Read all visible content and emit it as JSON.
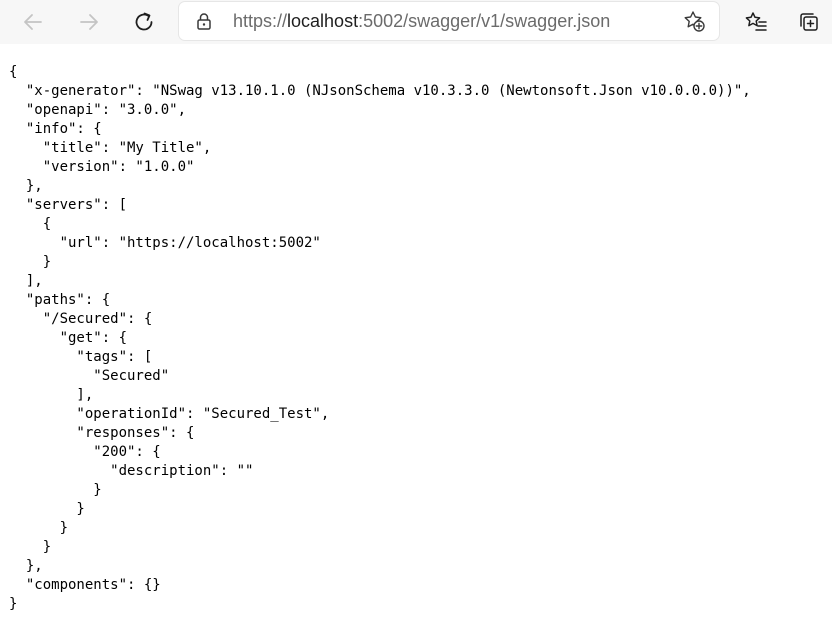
{
  "browser": {
    "url_prefix": "https://",
    "url_host": "localhost",
    "url_rest": ":5002/swagger/v1/swagger.json"
  },
  "icons": {
    "back": "back-arrow-icon",
    "forward": "forward-arrow-icon",
    "refresh": "refresh-icon",
    "lock": "lock-icon",
    "favorite": "add-favorite-star-icon",
    "favorites": "favorites-list-icon",
    "collections": "collections-icon"
  },
  "colors": {
    "toolbar_bg": "#f7f7f7",
    "disabled_icon": "#c4c4c4",
    "active_icon": "#1f1f1f"
  },
  "json_lines": [
    "{",
    "  \"x-generator\": \"NSwag v13.10.1.0 (NJsonSchema v10.3.3.0 (Newtonsoft.Json v10.0.0.0))\",",
    "  \"openapi\": \"3.0.0\",",
    "  \"info\": {",
    "    \"title\": \"My Title\",",
    "    \"version\": \"1.0.0\"",
    "  },",
    "  \"servers\": [",
    "    {",
    "      \"url\": \"https://localhost:5002\"",
    "    }",
    "  ],",
    "  \"paths\": {",
    "    \"/Secured\": {",
    "      \"get\": {",
    "        \"tags\": [",
    "          \"Secured\"",
    "        ],",
    "        \"operationId\": \"Secured_Test\",",
    "        \"responses\": {",
    "          \"200\": {",
    "            \"description\": \"\"",
    "          }",
    "        }",
    "      }",
    "    }",
    "  },",
    "  \"components\": {}",
    "}"
  ]
}
